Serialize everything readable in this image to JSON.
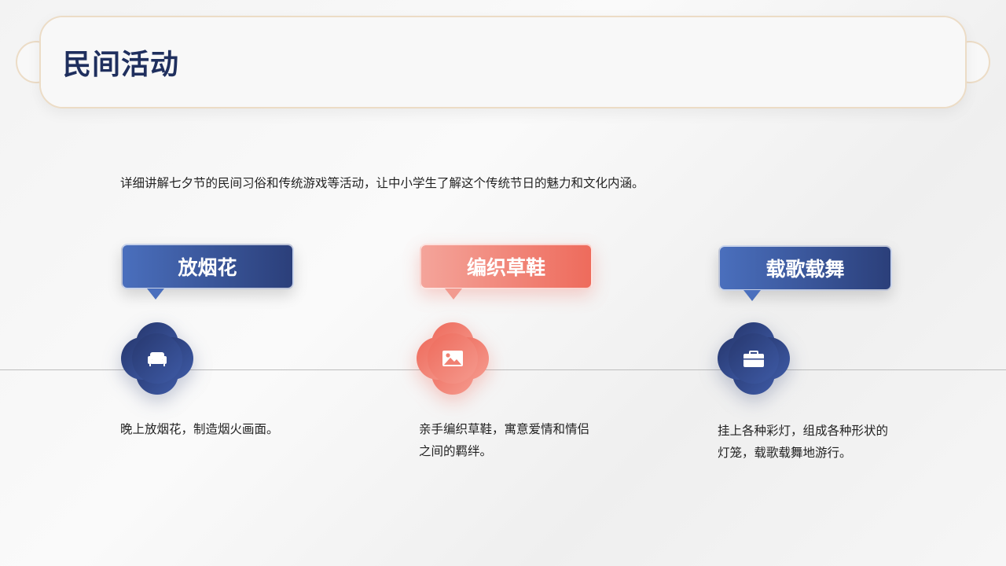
{
  "header": {
    "title": "民间活动"
  },
  "intro": "详细讲解七夕节的民间习俗和传统游戏等活动，让中小学生了解这个传统节日的魅力和文化内涵。",
  "items": [
    {
      "tag": "放烟花",
      "icon": "sofa-icon",
      "desc": "晚上放烟花，制造烟火画面。",
      "theme": "blue"
    },
    {
      "tag": "编织草鞋",
      "icon": "image-icon",
      "desc": "亲手编织草鞋，寓意爱情和情侣之间的羁绊。",
      "theme": "red"
    },
    {
      "tag": "载歌载舞",
      "icon": "briefcase-icon",
      "desc": "挂上各种彩灯，组成各种形状的灯笼，载歌载舞地游行。",
      "theme": "blue"
    }
  ],
  "colors": {
    "navy": "#1f2f5e",
    "blue": "#3e5aa5",
    "coral": "#ee6b5c"
  }
}
